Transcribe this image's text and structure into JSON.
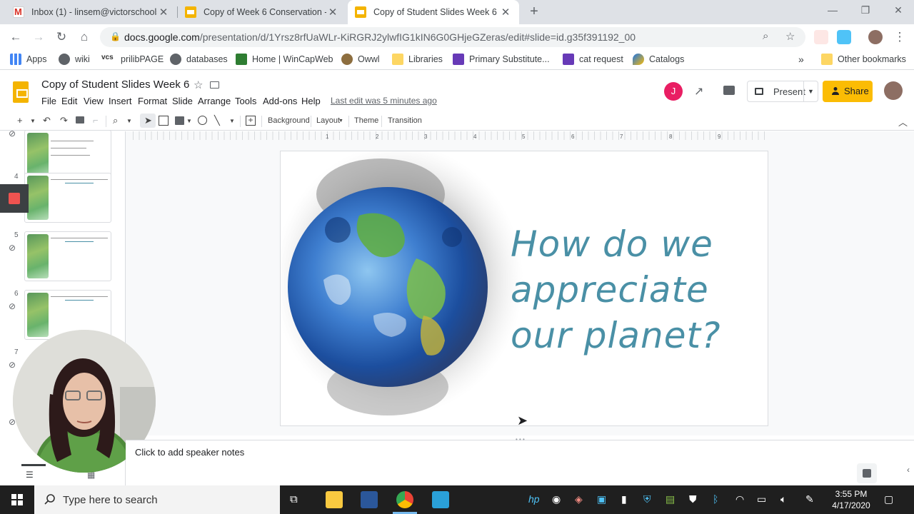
{
  "browser": {
    "tabs": [
      {
        "title": "Inbox (1) - linsem@victorschools",
        "favicon": "gmail-icon",
        "active": false
      },
      {
        "title": "Copy of Week 6 Conservation - G",
        "favicon": "slides-icon",
        "active": false
      },
      {
        "title": "Copy of Student Slides Week 6 -",
        "favicon": "slides-icon",
        "active": true
      }
    ],
    "new_tab_label": "+",
    "url_host": "docs.google.com",
    "url_path": "/presentation/d/1Yrsz8rfUaWLr-KiRGRJ2ylwfIG1kIN6G0GHjeGZeras/edit#slide=id.g35f391192_00"
  },
  "bookmarks": {
    "items": [
      {
        "label": "Apps",
        "icon": "apps-grid-icon"
      },
      {
        "label": "wiki",
        "icon": "globe-icon"
      },
      {
        "label": "prilibPAGE",
        "icon": "vcs-icon"
      },
      {
        "label": "databases",
        "icon": "globe-icon"
      },
      {
        "label": "Home | WinCapWeb",
        "icon": "wincap-icon"
      },
      {
        "label": "Owwl",
        "icon": "owl-icon"
      },
      {
        "label": "Libraries",
        "icon": "folder-icon"
      },
      {
        "label": "Primary Substitute...",
        "icon": "forms-icon"
      },
      {
        "label": "cat request",
        "icon": "forms-icon"
      },
      {
        "label": "Catalogs",
        "icon": "catalogs-icon"
      }
    ],
    "overflow_label": "»",
    "other_label": "Other bookmarks"
  },
  "doc": {
    "title": "Copy of Student Slides Week 6",
    "menus": [
      "File",
      "Edit",
      "View",
      "Insert",
      "Format",
      "Slide",
      "Arrange",
      "Tools",
      "Add-ons",
      "Help"
    ],
    "last_edit": "Last edit was 5 minutes ago",
    "collaborator_initial": "J",
    "present_label": "Present",
    "share_label": "Share"
  },
  "toolbar": {
    "background_label": "Background",
    "layout_label": "Layout",
    "theme_label": "Theme",
    "transition_label": "Transition"
  },
  "ruler": {
    "ticks": [
      "1",
      "2",
      "3",
      "4",
      "5",
      "6",
      "7",
      "8",
      "9"
    ]
  },
  "filmstrip": {
    "numbers": [
      "4",
      "5",
      "6",
      "7"
    ]
  },
  "slide": {
    "title": "How do we\nappreciate\nour planet?"
  },
  "notes": {
    "placeholder": "Click to add speaker notes"
  },
  "taskbar": {
    "search_placeholder": "Type here to search",
    "time": "3:55 PM",
    "date": "4/17/2020"
  },
  "colors": {
    "title_teal": "#4a90a6",
    "share_yellow": "#fbbc04",
    "slides_yellow": "#f4b400",
    "avatar_pink": "#e91e63"
  }
}
